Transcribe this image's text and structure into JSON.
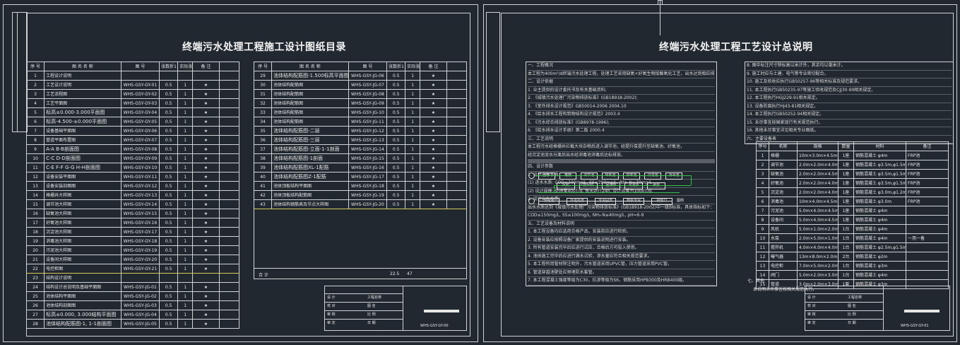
{
  "left_sheet": {
    "title": "终端污水处理工程施工设计图纸目录",
    "header_labels": [
      "序 号",
      "图 名 名 称",
      "图 号",
      "张数折1",
      "实际张数",
      "备 注"
    ],
    "rows": [
      [
        "1",
        "工程设计说明",
        "",
        "",
        "",
        ""
      ],
      [
        "2",
        "工艺设计说明",
        "WHS-GSY-GY-01",
        "0.5",
        "1",
        "★"
      ],
      [
        "3",
        "工艺流程图",
        "WHS-GSY-GY-02",
        "0.5",
        "1",
        "★"
      ],
      [
        "4",
        "工艺平面图",
        "WHS-GSY-GY-03",
        "0.5",
        "1",
        "★"
      ],
      [
        "5",
        "标高±0.000-3.000平面图",
        "WHS-GSY-GY-04",
        "0.5",
        "1",
        "★"
      ],
      [
        "6",
        "标高-4.500-±0.000平面图",
        "WHS-GSY-GY-05",
        "0.5",
        "1",
        "★"
      ],
      [
        "7",
        "设备基础平面图",
        "WHS-GSY-GY-06",
        "0.5",
        "1",
        "★"
      ],
      [
        "8",
        "管道平面布置图",
        "WHS-GSY-GY-07",
        "0.5",
        "1",
        "★"
      ],
      [
        "9",
        "A-A B-B剖面图",
        "WHS-GSY-GY-08",
        "0.5",
        "1",
        "★"
      ],
      [
        "10",
        "C-C D-D剖面图",
        "WHS-GSY-GY-09",
        "0.5",
        "1",
        "★"
      ],
      [
        "11",
        "C-E F-F G-G H-H剖面图",
        "WHS-GSY-GY-10",
        "0.5",
        "1",
        "★"
      ],
      [
        "12",
        "设备安装平面图",
        "WHS-GSY-GY-11",
        "0.5",
        "1",
        "★"
      ],
      [
        "13",
        "设备安装剖面图",
        "WHS-GSY-GY-12",
        "0.5",
        "1",
        "★"
      ],
      [
        "14",
        "格栅井大样图",
        "WHS-GSY-GY-13",
        "0.5",
        "1",
        "★"
      ],
      [
        "15",
        "调节池大样图",
        "WHS-GSY-GY-14",
        "0.5",
        "1",
        "★"
      ],
      [
        "16",
        "缺氧池大样图",
        "WHS-GSY-GY-15",
        "0.5",
        "1",
        "★"
      ],
      [
        "17",
        "好氧池大样图",
        "WHS-GSY-GY-16",
        "0.5",
        "1",
        "★"
      ],
      [
        "18",
        "沉淀池大样图",
        "WHS-GSY-GY-17",
        "0.5",
        "1",
        "★"
      ],
      [
        "19",
        "消毒池大样图",
        "WHS-GSY-GY-18",
        "0.5",
        "1",
        "★"
      ],
      [
        "20",
        "污泥池大样图",
        "WHS-GSY-GY-19",
        "0.5",
        "1",
        "★"
      ],
      [
        "21",
        "设备间大样图",
        "WHS-GSY-GY-20",
        "0.5",
        "1",
        "★"
      ],
      [
        "22",
        "电控柜图",
        "WHS-GSY-GY-21",
        "0.5",
        "1",
        "★"
      ],
      [
        "23",
        "结构设计说明",
        "",
        "",
        "",
        ""
      ],
      [
        "24",
        "结构设计总说明及基础平面图",
        "WHS-GSY-JG-01",
        "0.5",
        "1",
        "★"
      ],
      [
        "25",
        "池体结构平面图",
        "WHS-GSY-JG-02",
        "0.5",
        "1",
        "★"
      ],
      [
        "26",
        "池体结构剖面图",
        "WHS-GSY-JG-03",
        "0.5",
        "1",
        "★"
      ],
      [
        "27",
        "标高±0.000, 3.000结构平面图",
        "WHS-GSY-JG-04",
        "0.5",
        "1",
        "★"
      ],
      [
        "28",
        "池体结构配筋图-1, 1-1剖面图",
        "WHS-GSY-JG-05",
        "0.5",
        "1",
        "★"
      ]
    ],
    "rows_right": [
      [
        "29",
        "池体结构配筋图-1.500标高平面图",
        "WHS-GSY-JG-06",
        "0.5",
        "1",
        "★"
      ],
      [
        "30",
        "池体结构配筋图",
        "WHS-GSY-JG-07",
        "0.5",
        "1",
        "★"
      ],
      [
        "31",
        "池体结构配筋图",
        "WHS-GSY-JG-08",
        "0.5",
        "1",
        "★"
      ],
      [
        "32",
        "池体结构配筋图",
        "WHS-GSY-JG-09",
        "0.5",
        "1",
        "★"
      ],
      [
        "33",
        "池体结构配筋图",
        "WHS-GSY-JG-10",
        "0.5",
        "1",
        "★"
      ],
      [
        "34",
        "池体结构配筋图",
        "WHS-GSY-JG-11",
        "0.5",
        "1",
        "★"
      ],
      [
        "35",
        "池体结构配筋图-二层",
        "WHS-GSY-JG-12",
        "0.5",
        "1",
        "★"
      ],
      [
        "36",
        "池体结构配筋图-三层",
        "WHS-GSY-JG-13",
        "0.5",
        "1",
        "★"
      ],
      [
        "37",
        "池体结构配筋图-立面-1-1剖面",
        "WHS-GSY-JG-14",
        "0.5",
        "1",
        "★"
      ],
      [
        "38",
        "池体结构配筋图-1剖面",
        "WHS-GSY-JG-15",
        "0.5",
        "1",
        "★"
      ],
      [
        "39",
        "池体结构配筋图XL-1配筋",
        "WHS-GSY-JG-16",
        "0.5",
        "1",
        "★"
      ],
      [
        "40",
        "池体结构配筋图Z-1配筋",
        "WHS-GSY-JG-17",
        "0.5",
        "1",
        "★"
      ],
      [
        "41",
        "池体顶板结构平面图",
        "WHS-GSY-JG-18",
        "0.5",
        "1",
        "★"
      ],
      [
        "42",
        "池体顶板结构配筋图",
        "WHS-GSY-JG-19",
        "0.5",
        "1",
        "★"
      ],
      [
        "43",
        "池体结构钢筋表及节点大样图",
        "WHS-GSY-JG-20",
        "0.5",
        "1",
        "★"
      ]
    ],
    "total_label": "合 计",
    "total_value": "22.5",
    "total_count": "47",
    "titleblock_code": "WHS-GSY-GY-00"
  },
  "right_sheet": {
    "title": "终端污水处理工程工艺设计总说明",
    "notes_left": [
      "一、工程概况",
      "本工程为400m³/d终端污水处理工程，处理工艺采用缺氧+好氧生物接触氧化工艺，出水达到相应排放标准。",
      "二、设计依据",
      "1. 业主提供的设计委托书及有关基础资料;",
      "2. 《城镇污水处理厂污染物排放标准》(GB18918-2002);",
      "3. 《室外排水设计规范》GB50014-2006 2004.10",
      "4. 《给水排水工程构筑物结构设计规范》2003.4",
      "5. 《污水综合排放标准》(GB8978-1996);",
      "6. 《给水排水设计手册》第二版 2000.4",
      "三、工艺说明",
      "本工程污水经格栅井拦截大块杂物后进入调节池，经提升泵提升至缺氧池、好氧池，",
      "经沉淀池泥水分离后出水经消毒池消毒后达标排放。",
      "",
      "",
      "",
      "",
      "",
      "四、设计参数",
      "1. 设计进水水质：",
      "(1) 进水水质: COD≤200mg/L, SS≤200mg/L, NH₃-N≤30mg/L",
      "(2) 设计规模: 处理量400T/d, 每天运行24h, 设计流量为1000T/d.",
      "2. 设计出水水质：",
      "出水水质达到《城镇污水处理厂污染物排放标准》(GB18918-2002)中一级B标准，具体指标如下：",
      "COD≤150mg/L, SS≤100mg/L, NH₃-N≤40mg/L, pH=6-9",
      "五、工艺设备及材料说明",
      "1. 本工程设备均应选用合格产品，安装前应进行检验。",
      "2. 设备安装应按照设备厂家提供的安装说明进行安装。",
      "3. 所有管道安装完毕后应进行试压，合格后方可投入使用。",
      "4. 池体施工完毕后应进行满水试验，渗水量应符合相关规范要求。",
      "5. 本工程所用管材除注明外，污水管道采用UPVC管，压力管道采用PVC管。",
      "6. 管道穿越池壁处应预埋防水套管。",
      "7. 本工程混凝土强度等级为C30，抗渗等级为S6，钢筋采用HPB300及HRB400级。"
    ],
    "notes_right": [
      "8. 图中标注尺寸除标高以米计外，其余均以毫米计。",
      "9. 施工时应与土建、电气等专业密切配合。",
      "10. 施工及验收应执行GB50257-96等相关标准及规范要求。",
      "11. 本工程执行GB50235-97等施工验收规范及CJJ30-99相关规定。",
      "12. 本工程执行HGJ229-91相关规定。",
      "13. 设备防腐执行HJ43-81相关规定。",
      "14. 本工程执行GB50252-94相关规定。",
      "15. 未尽事宜按国家现行有关规范执行。",
      "16. 其他未尽事宜详见相关专业图纸。",
      "六、主要设备表"
    ],
    "equipment_headers": [
      "序号",
      "名称",
      "规格",
      "数量",
      "材料",
      "备注"
    ],
    "equipment_rows": [
      [
        "1",
        "格栅",
        "10m×3.0m×4.5m",
        "1座",
        "钢筋混凝土 φ4m",
        "FRP池"
      ],
      [
        "2",
        "调节池",
        "2.0m×2.0m×4.0m",
        "1座",
        "钢筋混凝土 φ3.5m,φ1.5m",
        "FRP池"
      ],
      [
        "3",
        "缺氧池",
        "2.0m×2.0m×4.5m",
        "1座",
        "钢筋混凝土 φ3.5m,φ1.5m",
        "FRP池"
      ],
      [
        "4",
        "好氧池",
        "2.0m×2.0m×4.0m",
        "1座",
        "钢筋混凝土 φ3.5m,φ1.5m",
        "FRP池"
      ],
      [
        "5",
        "沉淀池",
        "2.0m×2.0m×4.0m",
        "1座",
        "钢筋混凝土 φ3.0m,φ1.2m",
        "FRP池"
      ],
      [
        "6",
        "消毒池",
        "10m×4.0m×4.5m",
        "1座",
        "钢筋混凝土 φ3.0m",
        "FRP池"
      ],
      [
        "7",
        "污泥池",
        "5.0m×4.0m×4.5m",
        "1座",
        "钢筋混凝土 φ4m",
        ""
      ],
      [
        "8",
        "设备间",
        "5.0m×4.0m×4.5m",
        "1座",
        "钢筋混凝土 φ4m",
        ""
      ],
      [
        "9",
        "风机",
        "5.0m×1.0m×2.0m",
        "1台",
        "钢筋混凝土 φ4m",
        ""
      ],
      [
        "10",
        "水泵",
        "2.0m×5.0m×1.0m",
        "1台",
        "钢筋混凝土 φ4m",
        "一用一备"
      ],
      [
        "11",
        "搅拌机",
        "4.0m×4.0m×4.0m",
        "1台",
        "钢筋混凝土 φ2.5m,φ1.5m",
        ""
      ],
      [
        "12",
        "曝气器",
        "13m×8.0m×2.0m",
        "2台",
        "钢筋混凝土 φ2m",
        ""
      ],
      [
        "13",
        "电控柜",
        "7.0m×5.0m×2.0m",
        "1台",
        "钢筋混凝土 φ3m",
        ""
      ],
      [
        "14",
        "阀门",
        "5.0m×2.0m×3.0m",
        "1台",
        "钢筋混凝土 φ4m",
        ""
      ],
      [
        "15",
        "管道",
        "3.0m×2.0m×3.0m",
        "1套",
        "钢筋混凝土 φ3m",
        ""
      ]
    ],
    "bottom_note_heading": "七、其他",
    "bottom_note_text": "本说明未尽事宜按相关规范执行。",
    "titleblock_code": "WHS-GSY-GY-01"
  },
  "flow": {
    "row1": [
      "污水",
      "格栅",
      "调节池",
      "缺氧池",
      "好氧池",
      "沉淀池",
      "消毒池"
    ],
    "row2": [
      "风机",
      "鼓风机",
      "回流泵",
      "污泥泵",
      "排放"
    ],
    "row3": [
      "污泥池",
      "外运处置",
      "污泥回流",
      "剩余污泥",
      "排放口"
    ],
    "label_legend": "图例"
  },
  "titleblock_labels": [
    "设 计",
    "校 对",
    "审 核",
    "审 定",
    "工程名称",
    "图 名",
    "比 例",
    "日 期"
  ],
  "colors": {
    "background": "#212830",
    "line": "#cfd3d6",
    "highlight": "#d8c95a",
    "pink": "#ff3fd0",
    "flow_green": "#39c04a"
  }
}
